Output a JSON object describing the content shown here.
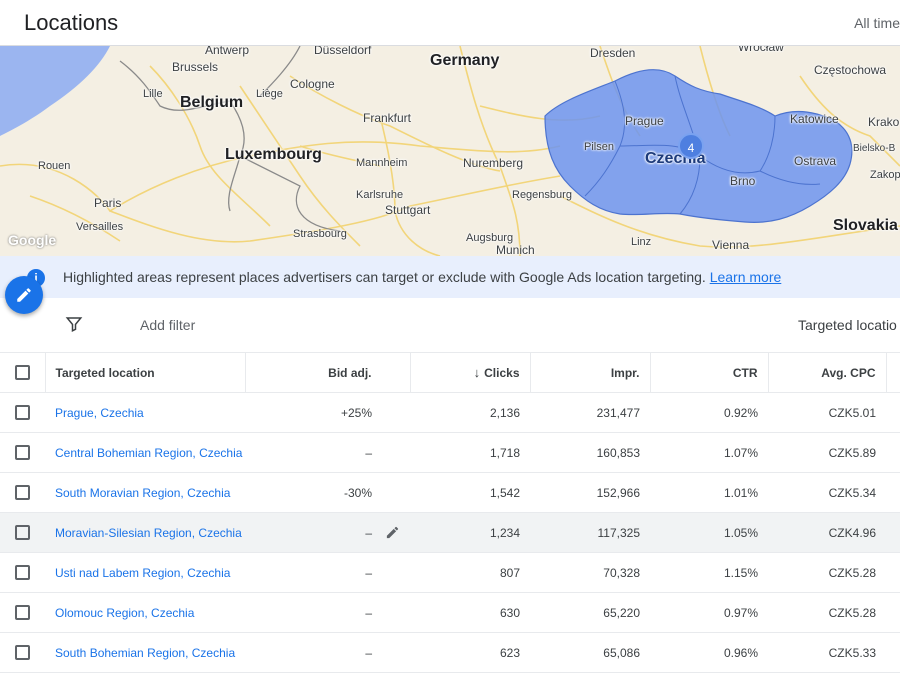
{
  "header": {
    "title": "Locations",
    "range": "All time"
  },
  "map": {
    "labels": {
      "germany": "Germany",
      "belgium": "Belgium",
      "luxembourg": "Luxembourg",
      "slovakia": "Slovakia",
      "czechia": "Czechia",
      "antwerp": "Antwerp",
      "dusseldorf": "Düsseldorf",
      "dresden": "Dresden",
      "wroclaw": "Wrocław",
      "czestochowa": "Częstochowa",
      "brussels": "Brussels",
      "cologne": "Cologne",
      "lille": "Lille",
      "liege": "Liège",
      "frankfurt": "Frankfurt",
      "prague": "Prague",
      "katowice": "Katowice",
      "krakow": "Krako",
      "pilsen": "Pilsen",
      "ostrava": "Ostrava",
      "bielsko": "Bielsko-B",
      "rouen": "Rouen",
      "mannheim": "Mannheim",
      "nuremberg": "Nuremberg",
      "brno": "Brno",
      "zakopane": "Zakop",
      "paris": "Paris",
      "karlsruhe": "Karlsruhe",
      "stuttgart": "Stuttgart",
      "regensburg": "Regensburg",
      "versailles": "Versailles",
      "strasbourg": "Strasbourg",
      "augsburg": "Augsburg",
      "munich": "Munich",
      "linz": "Linz",
      "vienna": "Vienna"
    },
    "cluster_count": "4",
    "google": "Google"
  },
  "info": {
    "text": "Highlighted areas represent places advertisers can target or exclude with Google Ads location targeting.",
    "link": "Learn more"
  },
  "filter": {
    "add_filter": "Add filter",
    "targeted": "Targeted locatio"
  },
  "table": {
    "headers": {
      "location": "Targeted location",
      "bid": "Bid adj.",
      "clicks": "Clicks",
      "impr": "Impr.",
      "ctr": "CTR",
      "cpc": "Avg. CPC"
    },
    "rows": [
      {
        "location": "Prague, Czechia",
        "bid": "+25%",
        "clicks": "2,136",
        "impr": "231,477",
        "ctr": "0.92%",
        "cpc": "CZK5.01"
      },
      {
        "location": "Central Bohemian Region, Czechia",
        "bid": "–",
        "clicks": "1,718",
        "impr": "160,853",
        "ctr": "1.07%",
        "cpc": "CZK5.89"
      },
      {
        "location": "South Moravian Region, Czechia",
        "bid": "-30%",
        "clicks": "1,542",
        "impr": "152,966",
        "ctr": "1.01%",
        "cpc": "CZK5.34"
      },
      {
        "location": "Moravian-Silesian Region, Czechia",
        "bid": "–",
        "clicks": "1,234",
        "impr": "117,325",
        "ctr": "1.05%",
        "cpc": "CZK4.96"
      },
      {
        "location": "Usti nad Labem Region, Czechia",
        "bid": "–",
        "clicks": "807",
        "impr": "70,328",
        "ctr": "1.15%",
        "cpc": "CZK5.28"
      },
      {
        "location": "Olomouc Region, Czechia",
        "bid": "–",
        "clicks": "630",
        "impr": "65,220",
        "ctr": "0.97%",
        "cpc": "CZK5.28"
      },
      {
        "location": "South Bohemian Region, Czechia",
        "bid": "–",
        "clicks": "623",
        "impr": "65,086",
        "ctr": "0.96%",
        "cpc": "CZK5.33"
      }
    ]
  },
  "colors": {
    "accent": "#1a73e8",
    "highlight": "#6d94ee",
    "map_bg": "#f4efe3",
    "water": "#9bb5f0"
  }
}
